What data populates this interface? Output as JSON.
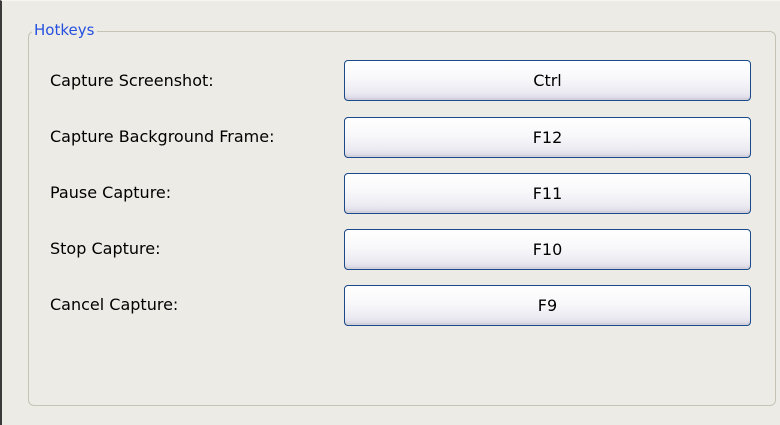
{
  "group": {
    "title": "Hotkeys"
  },
  "hotkeys": [
    {
      "label": "Capture Screenshot:",
      "key": "Ctrl"
    },
    {
      "label": "Capture Background Frame:",
      "key": "F12"
    },
    {
      "label": "Pause Capture:",
      "key": "F11"
    },
    {
      "label": "Stop Capture:",
      "key": "F10"
    },
    {
      "label": "Cancel Capture:",
      "key": "F9"
    }
  ],
  "colors": {
    "background": "#ecebe5",
    "group_title": "#2650e0",
    "button_border": "#1a4a8a"
  }
}
